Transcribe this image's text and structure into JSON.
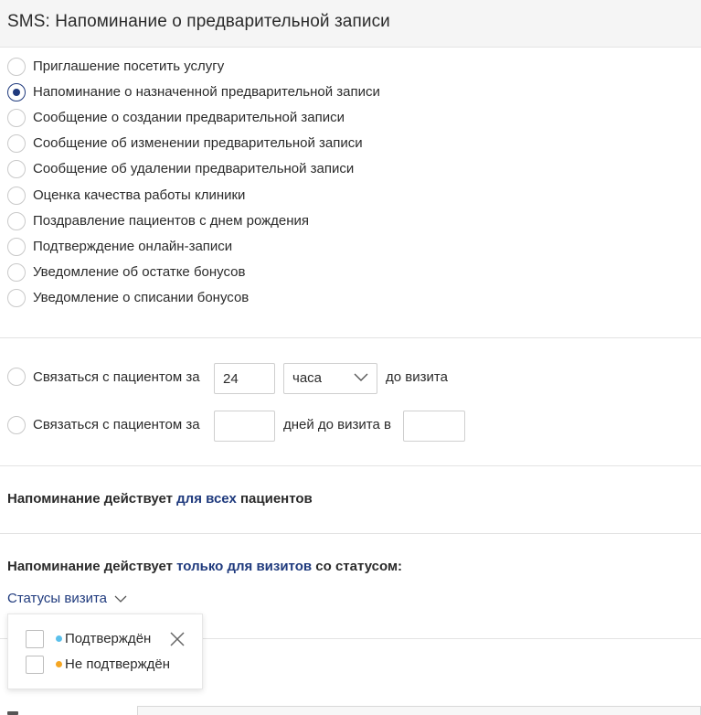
{
  "header": {
    "title": "SMS: Напоминание о предварительной записи"
  },
  "template_options": [
    {
      "label": "Приглашение посетить услугу",
      "checked": false
    },
    {
      "label": "Напоминание о назначенной предварительной записи",
      "checked": true
    },
    {
      "label": "Сообщение о создании предварительной записи",
      "checked": false
    },
    {
      "label": "Сообщение об изменении предварительной записи",
      "checked": false
    },
    {
      "label": "Сообщение об удалении предварительной записи",
      "checked": false
    },
    {
      "label": "Оценка качества работы клиники",
      "checked": false
    },
    {
      "label": "Поздравление пациентов с днем рождения",
      "checked": false
    },
    {
      "label": "Подтверждение онлайн-записи",
      "checked": false
    },
    {
      "label": "Уведомление об остатке бонусов",
      "checked": false
    },
    {
      "label": "Уведомление о списании бонусов",
      "checked": false
    }
  ],
  "timing": {
    "row1": {
      "prefix": "Связаться с пациентом за",
      "value": "24",
      "unit": "часа",
      "suffix": "до визита"
    },
    "row2": {
      "prefix": "Связаться с пациентом за",
      "value": "",
      "middle": "дней до визита в",
      "time_value": ""
    }
  },
  "scope": {
    "all": {
      "prefix": "Напоминание действует",
      "link": "для всех",
      "suffix": "пациентов"
    },
    "status": {
      "prefix": "Напоминание действует",
      "link": "только для визитов",
      "suffix": "со статусом:"
    }
  },
  "status_filter": {
    "label": "Статусы визита",
    "items": [
      {
        "label": "Подтверждён",
        "dot_color": "#5bc0eb"
      },
      {
        "label": "Не подтверждён",
        "dot_color": "#f5a623"
      }
    ]
  },
  "colors": {
    "accent": "#1f3a7d",
    "divider": "#e3e3e3"
  }
}
